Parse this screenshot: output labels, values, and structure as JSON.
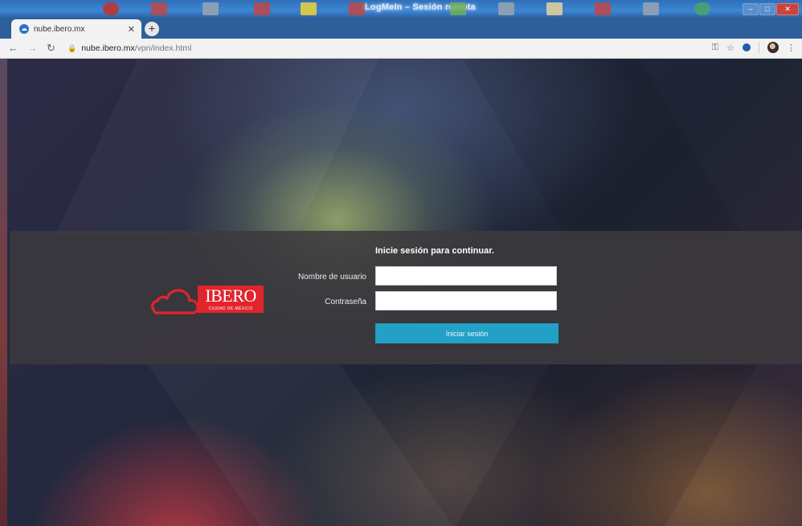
{
  "session": {
    "title": "LogMeIn – Sesión remota"
  },
  "browser": {
    "tab": {
      "title": "nube.ibero.mx"
    },
    "url": {
      "host": "nube.ibero.mx",
      "path": "/vpn/index.html"
    }
  },
  "brand": {
    "wordmark": "IBERO",
    "subtitle": "CIUDAD DE MÉXICO"
  },
  "login": {
    "heading": "Inicie sesión para continuar.",
    "username_label": "Nombre de usuario",
    "password_label": "Contraseña",
    "submit_label": "Iniciar sesión"
  },
  "colors": {
    "brand_red": "#e2242c",
    "submit_button": "#23a0c6"
  }
}
